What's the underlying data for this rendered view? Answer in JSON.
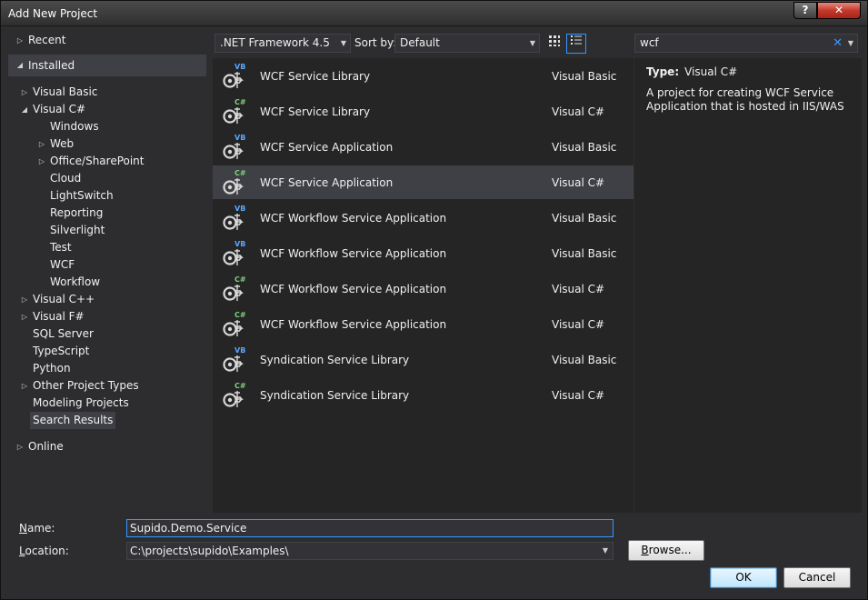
{
  "window": {
    "title": "Add New Project"
  },
  "tree": {
    "recent": "Recent",
    "installed": "Installed",
    "items": [
      {
        "label": "Visual Basic",
        "arrow": "▷"
      },
      {
        "label": "Visual C#",
        "arrow": "◢"
      },
      {
        "label": "Windows",
        "arrow": ""
      },
      {
        "label": "Web",
        "arrow": "▷"
      },
      {
        "label": "Office/SharePoint",
        "arrow": "▷"
      },
      {
        "label": "Cloud",
        "arrow": ""
      },
      {
        "label": "LightSwitch",
        "arrow": ""
      },
      {
        "label": "Reporting",
        "arrow": ""
      },
      {
        "label": "Silverlight",
        "arrow": ""
      },
      {
        "label": "Test",
        "arrow": ""
      },
      {
        "label": "WCF",
        "arrow": ""
      },
      {
        "label": "Workflow",
        "arrow": ""
      },
      {
        "label": "Visual C++",
        "arrow": "▷"
      },
      {
        "label": "Visual F#",
        "arrow": "▷"
      },
      {
        "label": "SQL Server",
        "arrow": ""
      },
      {
        "label": "TypeScript",
        "arrow": ""
      },
      {
        "label": "Python",
        "arrow": ""
      },
      {
        "label": "Other Project Types",
        "arrow": "▷"
      },
      {
        "label": "Modeling Projects",
        "arrow": ""
      },
      {
        "label": "Search Results",
        "arrow": ""
      }
    ],
    "online": "Online"
  },
  "toolbar": {
    "framework": ".NET Framework 4.5",
    "sort_label": "Sort by:",
    "sort_value": "Default"
  },
  "search": {
    "value": "wcf",
    "clear_icon": "✕"
  },
  "projects": [
    {
      "name": "WCF Service Library",
      "lang": "Visual Basic",
      "badge": "VB",
      "kind": "vb"
    },
    {
      "name": "WCF Service Library",
      "lang": "Visual C#",
      "badge": "C#",
      "kind": "cs"
    },
    {
      "name": "WCF Service Application",
      "lang": "Visual Basic",
      "badge": "VB",
      "kind": "vb"
    },
    {
      "name": "WCF Service Application",
      "lang": "Visual C#",
      "badge": "C#",
      "kind": "cs"
    },
    {
      "name": "WCF Workflow Service Application",
      "lang": "Visual Basic",
      "badge": "VB",
      "kind": "vb"
    },
    {
      "name": "WCF Workflow Service Application",
      "lang": "Visual Basic",
      "badge": "VB",
      "kind": "vb"
    },
    {
      "name": "WCF Workflow Service Application",
      "lang": "Visual C#",
      "badge": "C#",
      "kind": "cs"
    },
    {
      "name": "WCF Workflow Service Application",
      "lang": "Visual C#",
      "badge": "C#",
      "kind": "cs"
    },
    {
      "name": "Syndication Service Library",
      "lang": "Visual Basic",
      "badge": "VB",
      "kind": "vb"
    },
    {
      "name": "Syndication Service Library",
      "lang": "Visual C#",
      "badge": "C#",
      "kind": "cs"
    }
  ],
  "selected_index": 3,
  "description": {
    "type_label": "Type:",
    "type_value": "Visual C#",
    "text": "A project for creating WCF Service Application that is hosted in IIS/WAS"
  },
  "form": {
    "name_label_u": "N",
    "name_label_rest": "ame:",
    "name_value": "Supido.Demo.Service",
    "location_label_u": "L",
    "location_label_rest": "ocation:",
    "location_value": "C:\\projects\\supido\\Examples\\",
    "browse_u": "B",
    "browse_rest": "rowse...",
    "ok": "OK",
    "cancel": "Cancel"
  }
}
